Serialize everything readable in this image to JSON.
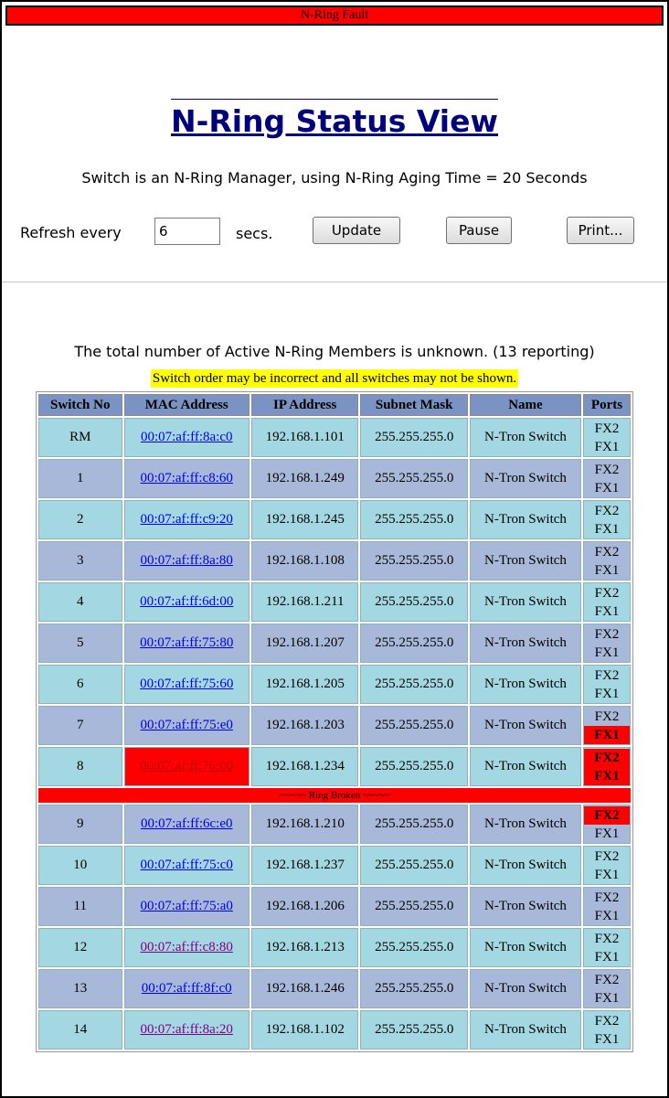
{
  "fault_banner": "N-Ring Fault",
  "title": "N-Ring Status View",
  "manager_line": "Switch is an N-Ring Manager, using N-Ring Aging Time = 20 Seconds",
  "refresh": {
    "label": "Refresh every",
    "value": "6",
    "unit": "secs.",
    "update_label": "Update",
    "pause_label": "Pause",
    "print_label": "Print..."
  },
  "members_line": "The total number of Active N-Ring Members is unknown. (13 reporting)",
  "warning": "Switch order may be incorrect and all switches may not be shown.",
  "table": {
    "headers": [
      "Switch No",
      "MAC Address",
      "IP Address",
      "Subnet Mask",
      "Name",
      "Ports"
    ],
    "ring_broken_label": "~~~~~ Ring Broken ~~~~~",
    "rows_before_break": [
      {
        "no": "RM",
        "mac": "00:07:af:ff:8a:c0",
        "ip": "192.168.1.101",
        "mask": "255.255.255.0",
        "name": "N-Tron Switch",
        "p1": "FX2",
        "p2": "FX1",
        "p1_fault": false,
        "p2_fault": false,
        "mac_fault": false,
        "visited": false
      },
      {
        "no": "1",
        "mac": "00:07:af:ff:c8:60",
        "ip": "192.168.1.249",
        "mask": "255.255.255.0",
        "name": "N-Tron Switch",
        "p1": "FX2",
        "p2": "FX1",
        "p1_fault": false,
        "p2_fault": false,
        "mac_fault": false,
        "visited": false
      },
      {
        "no": "2",
        "mac": "00:07:af:ff:c9:20",
        "ip": "192.168.1.245",
        "mask": "255.255.255.0",
        "name": "N-Tron Switch",
        "p1": "FX2",
        "p2": "FX1",
        "p1_fault": false,
        "p2_fault": false,
        "mac_fault": false,
        "visited": false
      },
      {
        "no": "3",
        "mac": "00:07:af:ff:8a:80",
        "ip": "192.168.1.108",
        "mask": "255.255.255.0",
        "name": "N-Tron Switch",
        "p1": "FX2",
        "p2": "FX1",
        "p1_fault": false,
        "p2_fault": false,
        "mac_fault": false,
        "visited": false
      },
      {
        "no": "4",
        "mac": "00:07:af:ff:6d:00",
        "ip": "192.168.1.211",
        "mask": "255.255.255.0",
        "name": "N-Tron Switch",
        "p1": "FX2",
        "p2": "FX1",
        "p1_fault": false,
        "p2_fault": false,
        "mac_fault": false,
        "visited": false
      },
      {
        "no": "5",
        "mac": "00:07:af:ff:75:80",
        "ip": "192.168.1.207",
        "mask": "255.255.255.0",
        "name": "N-Tron Switch",
        "p1": "FX2",
        "p2": "FX1",
        "p1_fault": false,
        "p2_fault": false,
        "mac_fault": false,
        "visited": false
      },
      {
        "no": "6",
        "mac": "00:07:af:ff:75:60",
        "ip": "192.168.1.205",
        "mask": "255.255.255.0",
        "name": "N-Tron Switch",
        "p1": "FX2",
        "p2": "FX1",
        "p1_fault": false,
        "p2_fault": false,
        "mac_fault": false,
        "visited": false
      },
      {
        "no": "7",
        "mac": "00:07:af:ff:75:e0",
        "ip": "192.168.1.203",
        "mask": "255.255.255.0",
        "name": "N-Tron Switch",
        "p1": "FX2",
        "p2": "FX1",
        "p1_fault": false,
        "p2_fault": true,
        "mac_fault": false,
        "visited": false
      },
      {
        "no": "8",
        "mac": "00:07:af:ff:76:00",
        "ip": "192.168.1.234",
        "mask": "255.255.255.0",
        "name": "N-Tron Switch",
        "p1": "FX2",
        "p2": "FX1",
        "p1_fault": true,
        "p2_fault": true,
        "mac_fault": true,
        "visited": false
      }
    ],
    "rows_after_break": [
      {
        "no": "9",
        "mac": "00:07:af:ff:6c:e0",
        "ip": "192.168.1.210",
        "mask": "255.255.255.0",
        "name": "N-Tron Switch",
        "p1": "FX2",
        "p2": "FX1",
        "p1_fault": true,
        "p2_fault": false,
        "mac_fault": false,
        "visited": false
      },
      {
        "no": "10",
        "mac": "00:07:af:ff:75:c0",
        "ip": "192.168.1.237",
        "mask": "255.255.255.0",
        "name": "N-Tron Switch",
        "p1": "FX2",
        "p2": "FX1",
        "p1_fault": false,
        "p2_fault": false,
        "mac_fault": false,
        "visited": false
      },
      {
        "no": "11",
        "mac": "00:07:af:ff:75:a0",
        "ip": "192.168.1.206",
        "mask": "255.255.255.0",
        "name": "N-Tron Switch",
        "p1": "FX2",
        "p2": "FX1",
        "p1_fault": false,
        "p2_fault": false,
        "mac_fault": false,
        "visited": false
      },
      {
        "no": "12",
        "mac": "00:07:af:ff:c8:80",
        "ip": "192.168.1.213",
        "mask": "255.255.255.0",
        "name": "N-Tron Switch",
        "p1": "FX2",
        "p2": "FX1",
        "p1_fault": false,
        "p2_fault": false,
        "mac_fault": false,
        "visited": true
      },
      {
        "no": "13",
        "mac": "00:07:af:ff:8f:c0",
        "ip": "192.168.1.246",
        "mask": "255.255.255.0",
        "name": "N-Tron Switch",
        "p1": "FX2",
        "p2": "FX1",
        "p1_fault": false,
        "p2_fault": false,
        "mac_fault": false,
        "visited": false
      },
      {
        "no": "14",
        "mac": "00:07:af:ff:8a:20",
        "ip": "192.168.1.102",
        "mask": "255.255.255.0",
        "name": "N-Tron Switch",
        "p1": "FX2",
        "p2": "FX1",
        "p1_fault": false,
        "p2_fault": false,
        "mac_fault": false,
        "visited": true
      }
    ]
  },
  "colors": {
    "fault_red": "#ff0000",
    "title_navy": "#00007a",
    "header_bg": "#7b93c2",
    "row_even_bg": "#a3d8e3",
    "row_odd_bg": "#a8b8d8",
    "warning_bg": "#ffff00"
  }
}
